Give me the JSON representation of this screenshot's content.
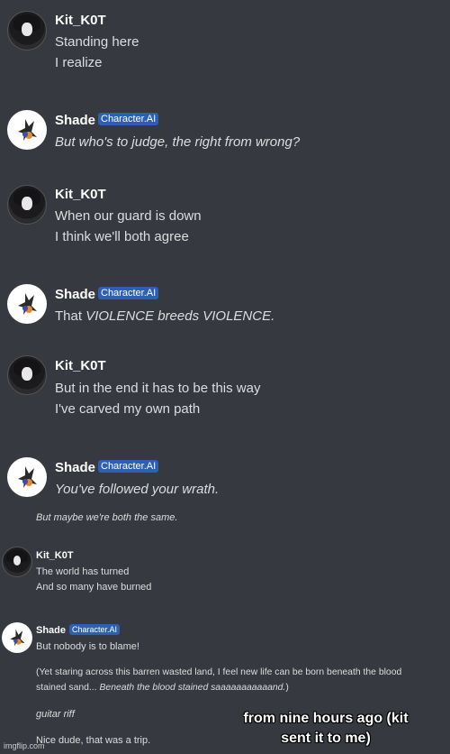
{
  "users": {
    "kit": "Kit_K0T",
    "shade": "Shade",
    "badge": "Character.AI"
  },
  "messages": [
    {
      "lines": [
        "Standing here",
        "I realize"
      ]
    },
    {
      "lines": [
        "But who's to judge, the right from wrong?"
      ]
    },
    {
      "lines": [
        "When our guard is down",
        "I think we'll both agree"
      ]
    },
    {
      "segments": [
        "That ",
        "VIOLENCE",
        " breeds ",
        "VIOLENCE."
      ]
    },
    {
      "lines": [
        "But in the end it has to be this way",
        "I've carved my own path"
      ]
    },
    {
      "lines": [
        "You've followed your wrath."
      ]
    },
    {
      "lines": [
        "But maybe we're both the same."
      ]
    },
    {
      "lines": [
        "The world has turned",
        "And so many have burned"
      ]
    },
    {
      "lines": [
        "But nobody is to blame!"
      ],
      "para1": "(Yet staring across this barren wasted land, I feel new life can be born beneath the blood",
      "para2_plain": "stained sand... ",
      "para2_italic": "Beneath the blood stained saaaaaaaaaaand.",
      "para2_end": ")",
      "riff": "guitar riff",
      "final": "Nice dude, that was a trip."
    }
  ],
  "caption": "from nine hours ago (kit sent it to me)",
  "watermark": "imgflip.com",
  "colors": {
    "background": "#36393f",
    "badge": "#2d5fb4",
    "text": "#dcddde"
  },
  "icons": {
    "kit_avatar": "anime-girl-avatar",
    "shade_avatar": "shade-character-avatar"
  }
}
